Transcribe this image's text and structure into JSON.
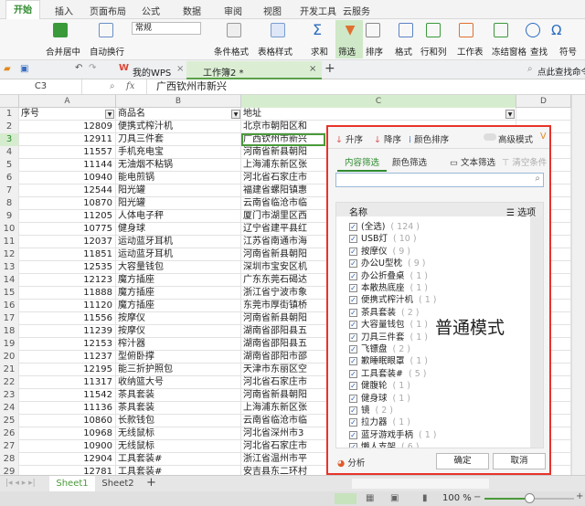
{
  "ribbon_tabs": [
    "开始",
    "插入",
    "页面布局",
    "公式",
    "数据",
    "审阅",
    "视图",
    "开发工具",
    "云服务"
  ],
  "ribbon_buttons": [
    "合并居中",
    "自动换行",
    "条件格式",
    "表格样式",
    "求和",
    "筛选",
    "排序",
    "格式",
    "行和列",
    "工作表",
    "冻结窗格",
    "查找",
    "符号"
  ],
  "number_format": "常规",
  "doc_tabs": {
    "wps": "我的WPS",
    "workbook": "工作簿2 *",
    "search": "点此查找命令"
  },
  "formula": {
    "cell_ref": "C3",
    "fx": "fx",
    "value": "广西钦州市新兴"
  },
  "columns": [
    "A",
    "B",
    "C",
    "D"
  ],
  "header_row": [
    "序号",
    "商品名",
    "地址"
  ],
  "rows": [
    [
      "2",
      "12809",
      "便携式榨汁机",
      "北京市朝阳区和"
    ],
    [
      "3",
      "12911",
      "刀具三件套",
      "广西钦州市新兴"
    ],
    [
      "4",
      "11557",
      "手机充电宝",
      "河南省新县朝阳"
    ],
    [
      "5",
      "11144",
      "无油烟不粘锅",
      "上海浦东新区张"
    ],
    [
      "6",
      "10940",
      "能电煎锅",
      "河北省石家庄市"
    ],
    [
      "7",
      "12544",
      "阳光罐",
      "福建省螺阳镇惠"
    ],
    [
      "8",
      "10870",
      "阳光罐",
      "云南省临沧市临"
    ],
    [
      "9",
      "11205",
      "人体电子秤",
      "厦门市湖里区西"
    ],
    [
      "10",
      "10775",
      "健身球",
      "辽宁省建平县红"
    ],
    [
      "11",
      "12037",
      "运动蓝牙耳机",
      "江苏省南通市海"
    ],
    [
      "12",
      "11851",
      "运动蓝牙耳机",
      "河南省新县朝阳"
    ],
    [
      "13",
      "12535",
      "大容量钱包",
      "深圳市宝安区机"
    ],
    [
      "14",
      "12123",
      "魔方插座",
      "广东东莞石碣达"
    ],
    [
      "15",
      "11888",
      "魔方插座",
      "浙江省宁波市象"
    ],
    [
      "16",
      "11120",
      "魔方插座",
      "东莞市厚街镇桥"
    ],
    [
      "17",
      "11556",
      "按摩仪",
      "河南省新县朝阳"
    ],
    [
      "18",
      "11239",
      "按摩仪",
      "湖南省邵阳县五"
    ],
    [
      "19",
      "12153",
      "榨汁器",
      "湖南省邵阳县五"
    ],
    [
      "20",
      "11237",
      "型俯卧撑",
      "湖南省邵阳市邵"
    ],
    [
      "21",
      "12195",
      "能三折护照包",
      "天津市东丽区空"
    ],
    [
      "22",
      "11317",
      "收纳篮大号",
      "河北省石家庄市"
    ],
    [
      "23",
      "11542",
      "茶具套装",
      "河南省新县朝阳"
    ],
    [
      "24",
      "11136",
      "茶具套装",
      "上海浦东新区张"
    ],
    [
      "25",
      "10860",
      "长款钱包",
      "云南省临沧市临"
    ],
    [
      "26",
      "10968",
      "无线鼠标",
      "河北省深州市3"
    ],
    [
      "27",
      "10900",
      "无线鼠标",
      "河北省石家庄市"
    ],
    [
      "28",
      "12904",
      "工具套装#",
      "浙江省温州市平"
    ],
    [
      "29",
      "12781",
      "工具套装#",
      "安吉县东二环村"
    ]
  ],
  "filter_panel": {
    "sort_asc": "升序",
    "sort_desc": "降序",
    "sort_color": "颜色排序",
    "advanced": "高级模式",
    "tab_content": "内容筛选",
    "tab_color": "颜色筛选",
    "text_filter": "文本筛选",
    "clear": "清空条件",
    "search_placeholder": "",
    "list_header": "名称",
    "options": "选项",
    "items": [
      {
        "label": "(全选)",
        "count": "( 124 )",
        "checked": true
      },
      {
        "label": "USB灯",
        "count": "( 10 )",
        "checked": true
      },
      {
        "label": "按摩仪",
        "count": "( 9 )",
        "checked": true
      },
      {
        "label": "办公U型枕",
        "count": "( 9 )",
        "checked": true
      },
      {
        "label": "办公折叠桌",
        "count": "( 1 )",
        "checked": true
      },
      {
        "label": "本散热底座",
        "count": "( 1 )",
        "checked": true
      },
      {
        "label": "便携式榨汁机",
        "count": "( 1 )",
        "checked": true
      },
      {
        "label": "茶具套装",
        "count": "( 2 )",
        "checked": true
      },
      {
        "label": "大容量钱包",
        "count": "( 1 )",
        "checked": true
      },
      {
        "label": "刀具三件套",
        "count": "( 1 )",
        "checked": true
      },
      {
        "label": "飞镖盘",
        "count": "( 2 )",
        "checked": true
      },
      {
        "label": "歉睡眠眼罩",
        "count": "( 1 )",
        "checked": true
      },
      {
        "label": "工具套装#",
        "count": "( 5 )",
        "checked": true
      },
      {
        "label": "健腹轮",
        "count": "( 1 )",
        "checked": true
      },
      {
        "label": "健身球",
        "count": "( 1 )",
        "checked": true
      },
      {
        "label": "镜",
        "count": "( 2 )",
        "checked": true
      },
      {
        "label": "拉力器",
        "count": "( 1 )",
        "checked": true
      },
      {
        "label": "蓝牙游戏手柄",
        "count": "( 1 )",
        "checked": true
      },
      {
        "label": "懒人支架",
        "count": "( 6 )",
        "checked": true
      },
      {
        "label": "魔方插座",
        "count": "( 3 )",
        "checked": true
      }
    ],
    "overlay_text": "普通模式",
    "analyze": "分析",
    "ok": "确定",
    "cancel": "取消"
  },
  "sheets": [
    "Sheet1",
    "Sheet2"
  ],
  "zoom": "100 %",
  "accent": "#2e8b2e",
  "highlight": "#e8322b"
}
